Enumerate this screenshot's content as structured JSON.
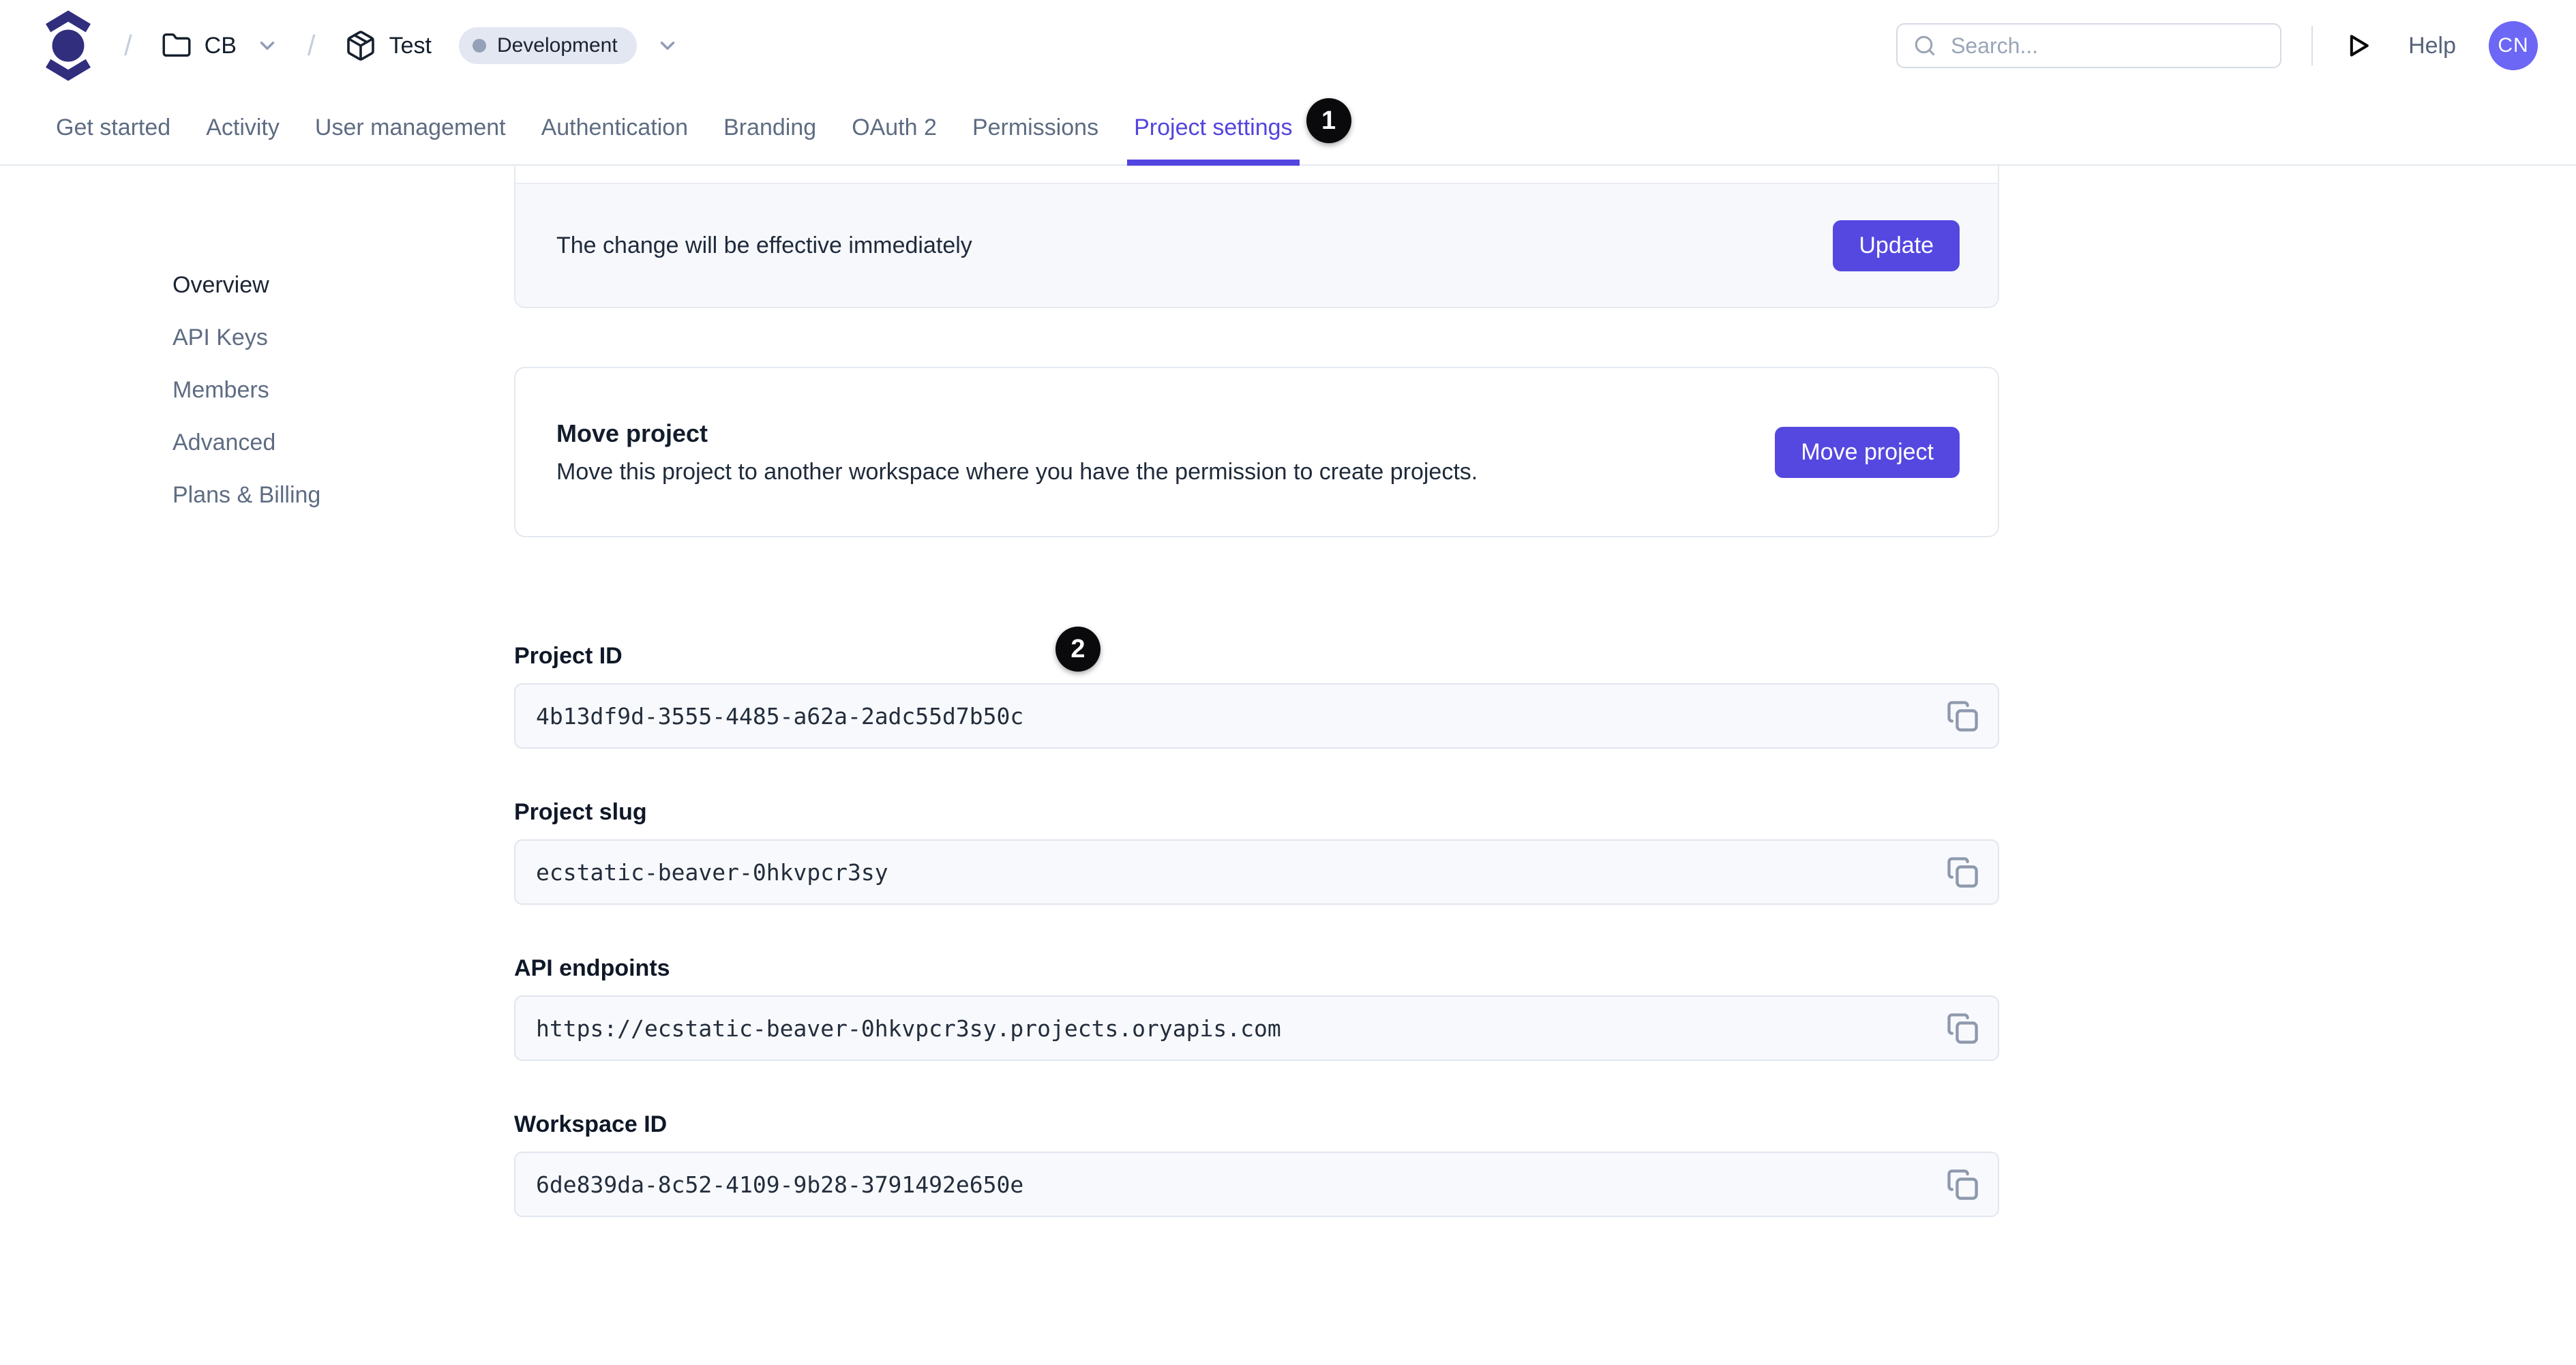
{
  "header": {
    "breadcrumb": {
      "separator": "/",
      "workspace_label": "CB",
      "project_label": "Test",
      "environment_badge": "Development"
    },
    "search": {
      "placeholder": "Search..."
    },
    "help_label": "Help",
    "avatar_initials": "CN"
  },
  "tabs": {
    "items": [
      {
        "label": "Get started"
      },
      {
        "label": "Activity"
      },
      {
        "label": "User management"
      },
      {
        "label": "Authentication"
      },
      {
        "label": "Branding"
      },
      {
        "label": "OAuth 2"
      },
      {
        "label": "Permissions"
      },
      {
        "label": "Project settings"
      }
    ],
    "active_tab": "Project settings",
    "annotation_badge": "1"
  },
  "sidebar": {
    "items": [
      {
        "label": "Overview"
      },
      {
        "label": "API Keys"
      },
      {
        "label": "Members"
      },
      {
        "label": "Advanced"
      },
      {
        "label": "Plans & Billing"
      }
    ],
    "active_item": "Overview"
  },
  "main": {
    "annotation_badge": "2",
    "update_card": {
      "note": "The change will be effective immediately",
      "button_label": "Update"
    },
    "move_card": {
      "title": "Move project",
      "description": "Move this project to another workspace where you have the permission to create projects.",
      "button_label": "Move project"
    },
    "fields": [
      {
        "label": "Project ID",
        "value": "4b13df9d-3555-4485-a62a-2adc55d7b50c"
      },
      {
        "label": "Project slug",
        "value": "ecstatic-beaver-0hkvpcr3sy"
      },
      {
        "label": "API endpoints",
        "value": "https://ecstatic-beaver-0hkvpcr3sy.projects.oryapis.com"
      },
      {
        "label": "Workspace ID",
        "value": "6de839da-8c52-4109-9b28-3791492e650e"
      }
    ]
  },
  "colors": {
    "accent": "#5548e0",
    "active_tab": "#5244df",
    "logo": "#312e7e",
    "avatar_bg": "#6c67f4",
    "annotation_bg": "#0a0a0d",
    "muted_text": "#5e6c82",
    "field_bg": "#f7f9fc",
    "badge_bg": "#e3e7f2"
  }
}
